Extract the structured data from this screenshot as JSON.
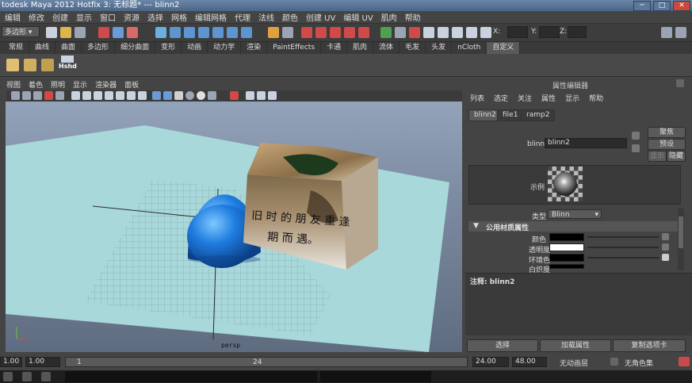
{
  "window": {
    "title": "todesk Maya 2012 Hotfix 3: 无标题*  ---  blinn2",
    "btn_min": "─",
    "btn_max": "□",
    "btn_close": "✕"
  },
  "menubar": [
    "编辑",
    "修改",
    "创建",
    "显示",
    "窗口",
    "资源",
    "选择",
    "网格",
    "编辑网格",
    "代理",
    "法线",
    "颜色",
    "创建 UV",
    "编辑 UV",
    "肌肉",
    "帮助"
  ],
  "toolbar": {
    "mode_select": "多边形",
    "x_label": "X:",
    "y_label": "Y:",
    "z_label": "Z:"
  },
  "shelf_tabs": [
    "常规",
    "曲线",
    "曲面",
    "多边形",
    "细分曲面",
    "变形",
    "动画",
    "动力学",
    "渲染",
    "PaintEffects",
    "卡通",
    "肌肉",
    "流体",
    "毛发",
    "头发",
    "nCloth",
    "自定义"
  ],
  "shelf_active": "自定义",
  "shelf_item_label": "Hshd",
  "viewport": {
    "menu": [
      "视图",
      "着色",
      "照明",
      "显示",
      "渲染器",
      "面板"
    ],
    "camera_label": "persp",
    "cube_text_line1": "旧 时 的 朋 友 重 逢",
    "cube_text_line2": "期 而 遇。"
  },
  "attr_editor": {
    "title": "属性编辑器",
    "menu": [
      "列表",
      "选定",
      "关注",
      "属性",
      "显示",
      "帮助"
    ],
    "tabs": [
      "blinn2",
      "file1",
      "ramp2"
    ],
    "active_tab": "blinn2",
    "node_label": "blinn:",
    "node_value": "blinn2",
    "btn_focus": "聚焦",
    "btn_presets": "预设",
    "btn_show": "显示",
    "btn_hide": "隐藏",
    "sample_label": "示例",
    "type_label": "类型",
    "type_value": "Blinn",
    "section_title": "公用材质属性",
    "attrs": [
      {
        "label": "颜色",
        "swatch": "#000000"
      },
      {
        "label": "透明度",
        "swatch": "#ffffff"
      },
      {
        "label": "环境色",
        "swatch": "#000000"
      },
      {
        "label": "白炽度",
        "swatch": "#000000"
      }
    ],
    "notes_label": "注释:  blinn2",
    "bottom_buttons": [
      "选择",
      "加载属性",
      "复制选项卡"
    ]
  },
  "timeline": {
    "start": "1.00",
    "current": "1.00",
    "frame_start": "1",
    "frame_end": "24",
    "range_end": "24.00",
    "max": "48.00",
    "anim_layer": "无动画层",
    "char_set": "无角色集"
  },
  "colors": {
    "accent": "#6a86a8",
    "ground": "#a8d8da",
    "sphere": "#1f7de0"
  }
}
